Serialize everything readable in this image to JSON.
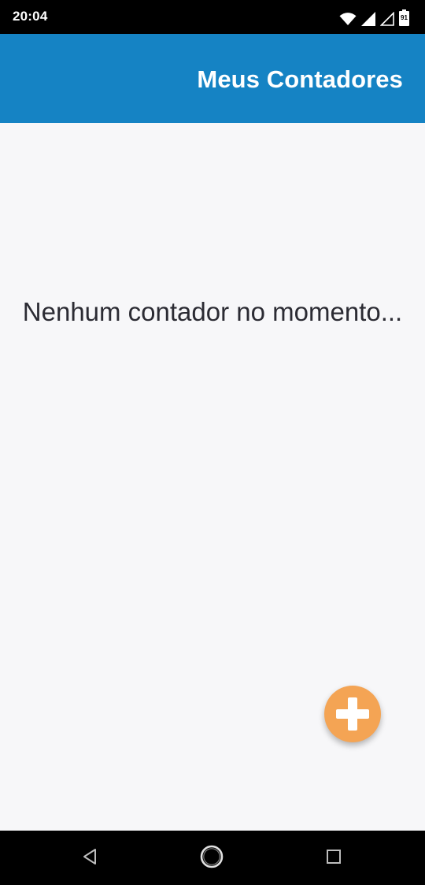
{
  "status_bar": {
    "time": "20:04",
    "battery_level": "91",
    "icons": [
      "wifi-icon",
      "signal-icon",
      "signal-empty-icon",
      "battery-icon"
    ]
  },
  "app_bar": {
    "title": "Meus Contadores",
    "color": "#1583c4"
  },
  "content": {
    "empty_message": "Nenhum contador no momento..."
  },
  "fab": {
    "icon": "plus-icon",
    "color": "#f4a454"
  },
  "nav_bar": {
    "buttons": [
      "back-icon",
      "home-icon",
      "recents-icon"
    ]
  }
}
